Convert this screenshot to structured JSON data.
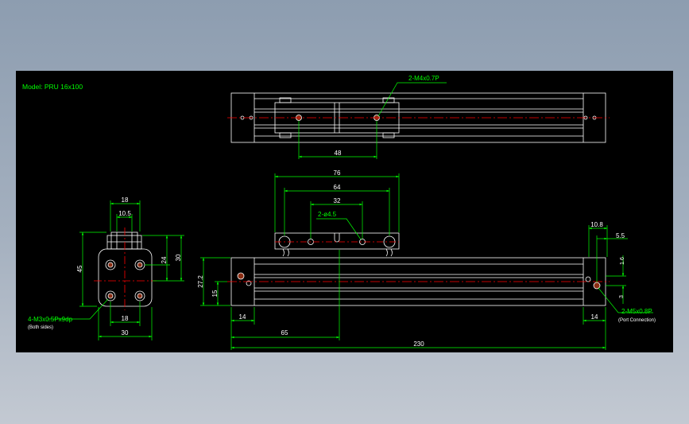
{
  "colors": {
    "background": "#000000",
    "outline": "#ffffff",
    "dimension": "#00ff00",
    "centerline": "#ff0000",
    "hole_fill": "#8b2e14"
  },
  "title": "Model: PRU 16x100",
  "top_view": {
    "callout": "2-M4x0.7P",
    "dims": {
      "hole_pitch": "48"
    }
  },
  "front_view": {
    "dims": {
      "carriage_length": "76",
      "outer_hole_pitch": "64",
      "inner_hole_pitch": "32",
      "head_length_left": "14",
      "head_length_right": "14",
      "carriage_offset": "65",
      "overall_length": "230",
      "height": "27.2",
      "center_height": "15",
      "end_width": "10.8",
      "port_offset": "5.5",
      "port_height_a": "1.6",
      "port_height_b": "3"
    },
    "callouts": {
      "carriage_holes": "2-ø4.5",
      "port": "2-M5x0.8P",
      "port_note": "(Port Connection)"
    }
  },
  "end_view": {
    "dims": {
      "top_width": "18",
      "inner_width": "10.5",
      "hole_pitch_width": "18",
      "base_width": "30",
      "overall_height": "45",
      "upper_height": "30",
      "hole_pitch_height": "24"
    },
    "callout": "4-M3x0.5Px9dp",
    "callout_note": "(Both sides)"
  }
}
